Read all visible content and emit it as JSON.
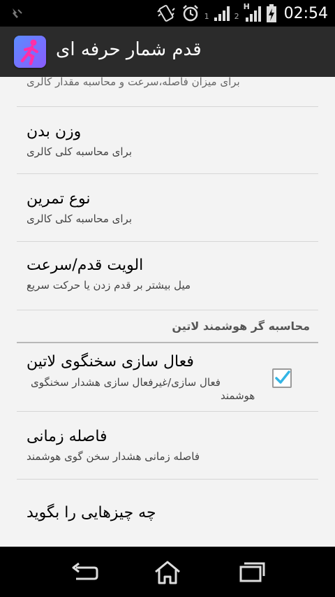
{
  "status_bar": {
    "time": "02:54",
    "sim1_label": "1",
    "sim2_label": "2",
    "network_label": "H",
    "icons": [
      "notification-icon",
      "vibrate-icon",
      "alarm-icon",
      "signal-sim1-icon",
      "signal-sim2-icon",
      "battery-charging-icon"
    ]
  },
  "action_bar": {
    "title": "قدم شمار حرفه ای",
    "app_icon": "runner-app-icon"
  },
  "preferences": {
    "partial_summary": "برای میزان فاصله،سرعت و محاسبه مقدار کالری",
    "items": [
      {
        "title": "وزن بدن",
        "summary": "برای محاسبه کلی کالری"
      },
      {
        "title": "نوع تمرین",
        "summary": "برای محاسبه کلی کالری"
      },
      {
        "title": "الویت قدم/سرعت",
        "summary": "میل بیشتر بر قدم زدن یا حرکت سریع"
      }
    ],
    "category": "محاسبه گر هوشمند لاتین",
    "smart_items": [
      {
        "title": "فعال سازی سخنگوی لاتین",
        "summary_line1": "فعال سازی/غیرفعال سازی هشدار سخنگوی",
        "summary_line2": "هوشمند",
        "checked": true
      },
      {
        "title": "فاصله زمانی",
        "summary": "فاصله زمانی هشدار سخن گوی هوشمند"
      },
      {
        "title": "چه چیزهایی را بگوید"
      }
    ]
  },
  "colors": {
    "accent": "#33b5e5",
    "status_bar": "#000000",
    "action_bar": "#2b2b2b",
    "list_background": "#f3f3f3"
  },
  "nav_bar": {
    "icons": [
      "back-icon",
      "home-icon",
      "recent-apps-icon"
    ]
  }
}
